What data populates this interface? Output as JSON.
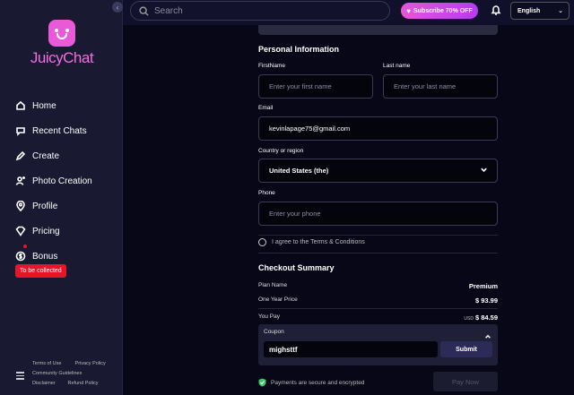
{
  "sidebar": {
    "logo": {
      "word1": "Juicy",
      "word2": "Chat"
    },
    "items": [
      {
        "label": "Home",
        "icon": "home-icon"
      },
      {
        "label": "Recent Chats",
        "icon": "chat-icon"
      },
      {
        "label": "Create",
        "icon": "create-icon"
      },
      {
        "label": "Photo Creation",
        "icon": "photo-creation-icon"
      },
      {
        "label": "Profile",
        "icon": "profile-icon"
      },
      {
        "label": "Pricing",
        "icon": "pricing-icon"
      },
      {
        "label": "Bonus",
        "icon": "bonus-icon"
      }
    ],
    "bonus_badge": "To be collected",
    "footer_links": [
      "Terms of Use",
      "Privacy Policy",
      "Community Guidelines",
      "Disclaimer",
      "Refund Policy"
    ]
  },
  "header": {
    "search_placeholder": "Search",
    "subscribe_label": "Subscribe 70% OFF",
    "language": "English"
  },
  "form": {
    "personal_title": "Personal Information",
    "first_name_label": "FirstName",
    "first_name_placeholder": "Enter your first name",
    "last_name_label": "Last name",
    "last_name_placeholder": "Enter your last name",
    "email_label": "Email",
    "email_value": "kevinlapage75@gmail.com",
    "country_label": "Country or region",
    "country_value": "United States (the)",
    "phone_label": "Phone",
    "phone_placeholder": "Enter your phone",
    "agree_text": "I agree to the Terms & Conditions"
  },
  "checkout": {
    "title": "Checkout Summary",
    "plan_name_label": "Plan Name",
    "plan_name_value": "Premium",
    "price_label": "One Year Price",
    "price_value": "$ 93.99",
    "you_pay_label": "You Pay",
    "you_pay_currency": "USD",
    "you_pay_value": "$ 84.59",
    "coupon_label": "Coupon",
    "coupon_value": "mighsttf",
    "coupon_submit": "Submit",
    "secure_text": "Payments are secure and encrypted",
    "pay_now": "Pay Now"
  },
  "colors": {
    "accent": "#e656d8",
    "badge": "#e8142a",
    "secure": "#3bc46a"
  }
}
